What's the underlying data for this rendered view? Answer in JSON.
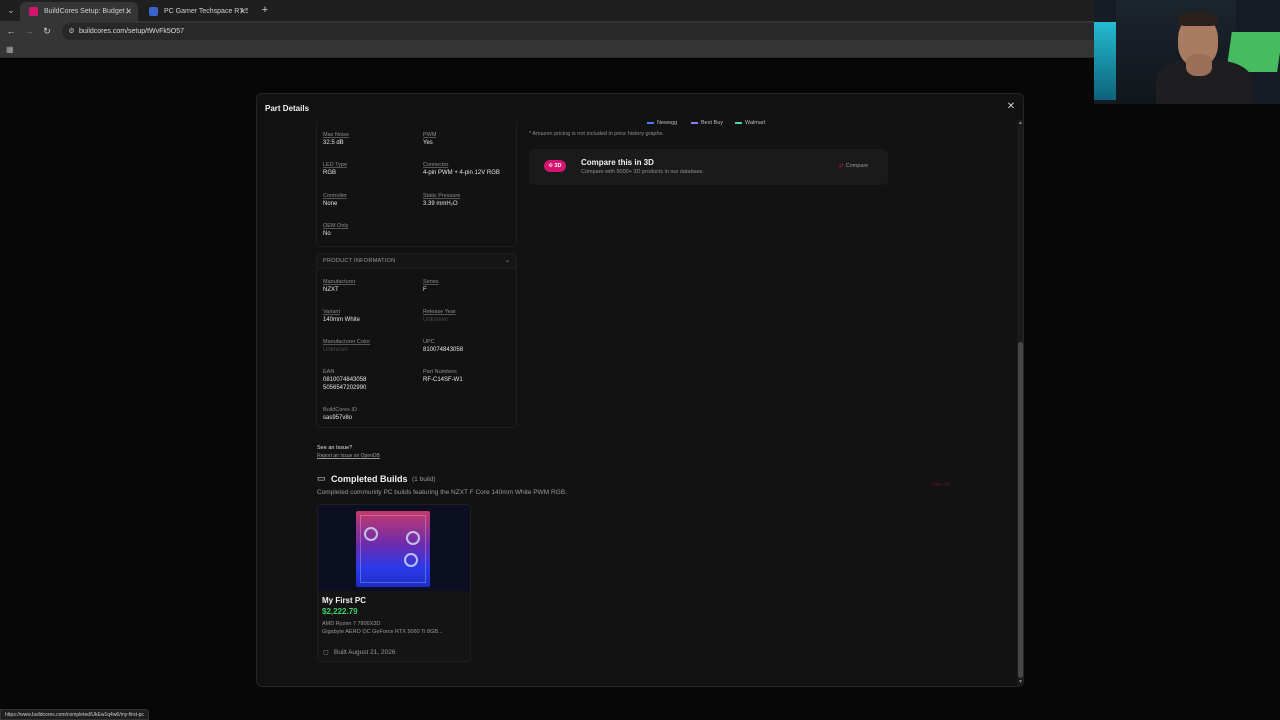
{
  "browser": {
    "tabs": [
      {
        "title": "BuildCores Setup: Budget $44...",
        "active": true,
        "favicon_color": "#d4146e"
      },
      {
        "title": "PC Gamer Techspace R7 5700X...",
        "active": false,
        "favicon_color": "#3a63c9"
      }
    ],
    "url": "buildcores.com/setup/tWvFk5O57",
    "status_url": "https://www.buildcores.com/completed/UkEw1q4w6/my-first-pc"
  },
  "modal": {
    "title": "Part Details",
    "specs": [
      {
        "label": "Max Noise",
        "value": "32.5 dB"
      },
      {
        "label": "PWM",
        "value": "Yes"
      },
      {
        "label": "LED Type",
        "value": "RGB"
      },
      {
        "label": "Connector",
        "value": "4-pin PWM + 4-pin 12V RGB"
      },
      {
        "label": "Controller",
        "value": "None"
      },
      {
        "label": "Static Pressure",
        "value": "3.39 mmH₂O"
      },
      {
        "label": "OEM Only",
        "value": "No"
      }
    ],
    "product_info": {
      "heading": "PRODUCT INFORMATION",
      "fields": [
        {
          "label": "Manufacturer",
          "value": "NZXT"
        },
        {
          "label": "Series",
          "value": "F"
        },
        {
          "label": "Variant",
          "value": "140mm White"
        },
        {
          "label": "Release Year",
          "value": "Unknown"
        },
        {
          "label": "Manufacturer Color",
          "value": "Unknown"
        },
        {
          "label": "UPC",
          "value": "810074843058"
        },
        {
          "label": "EAN",
          "value": "0810074843058",
          "value2": "5056547202990"
        },
        {
          "label": "Part Numbers",
          "value": "RF-C14SF-W1"
        },
        {
          "label": "BuildCores ID",
          "value": "sas957v8o"
        }
      ]
    },
    "issue": {
      "question": "See an Issue?",
      "link": "Report an Issue on OpenDB"
    },
    "retailers": [
      {
        "name": "Newegg",
        "color": "#4f7cf0"
      },
      {
        "name": "Best Buy",
        "color": "#8a7ff0"
      },
      {
        "name": "Walmart",
        "color": "#4fd6a0"
      }
    ],
    "amazon_note": "* Amazon pricing is not included in price history graphs.",
    "compare": {
      "badge": "3D",
      "title": "Compare this in 3D",
      "subtitle": "Compare with 5000+ 3D products in our database.",
      "button": "Compare"
    },
    "completed_builds": {
      "title": "Completed Builds",
      "count": "(1 build)",
      "subtitle": "Completed community PC builds featuring the NZXT F Core 140mm White PWM RGB.",
      "view_all": "View all",
      "builds": [
        {
          "name": "My First PC",
          "price": "$2,222.79",
          "cpu": "AMD Ryzen 7 7800X3D",
          "gpu": "Gigabyte AERO OC GeForce RTX 5060 Ti 8GB...",
          "date": "Built August 21, 2026"
        }
      ]
    }
  }
}
